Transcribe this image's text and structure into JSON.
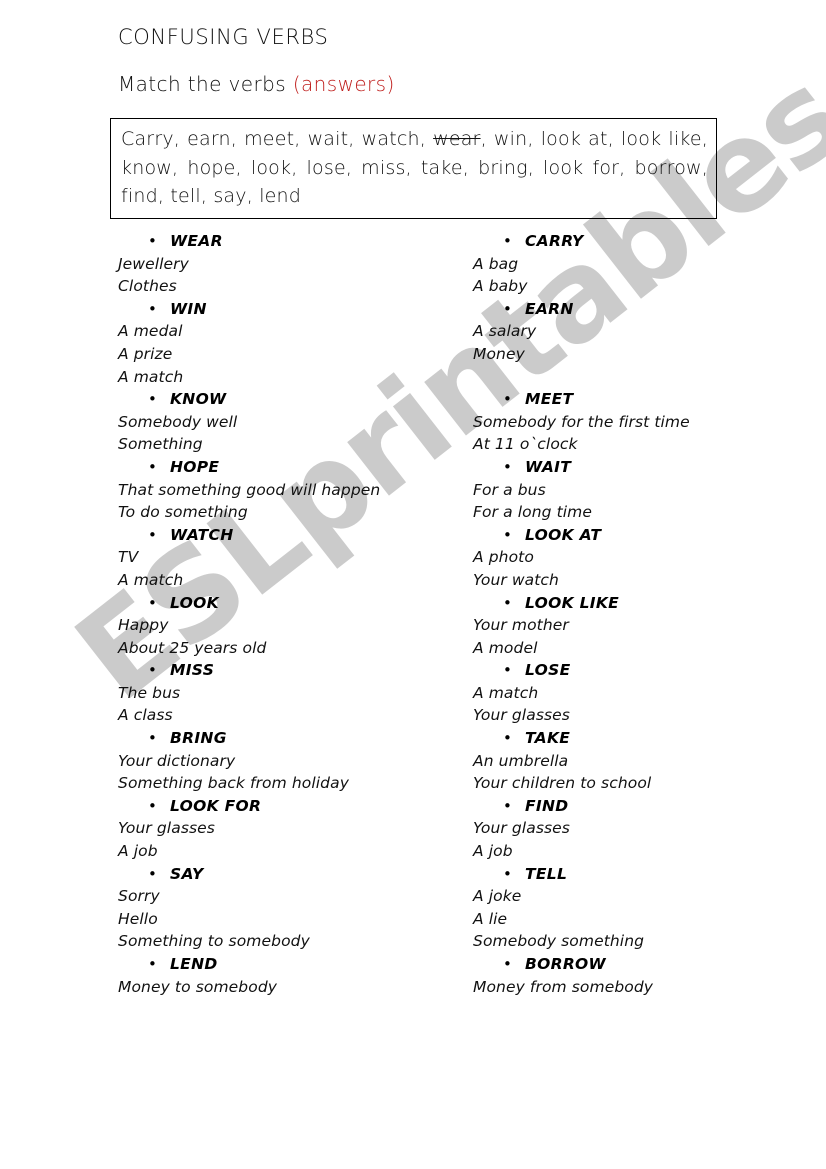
{
  "header": {
    "title": "CONFUSING VERBS",
    "subtitle_main": "Match the verbs ",
    "subtitle_answers": "(answers)"
  },
  "wordbank": {
    "before_struck": "Carry, earn, meet, wait, watch, ",
    "struck": "wear",
    "after_struck": ", win, look at, look like, know, hope, look, lose, miss, take, bring, look for, borrow, find, tell, say, lend"
  },
  "bullet_glyph": "•",
  "columns": {
    "left": [
      {
        "verb": "WEAR",
        "items": [
          "Jewellery",
          "Clothes"
        ]
      },
      {
        "verb": "WIN",
        "items": [
          "A medal",
          "A prize",
          "A match"
        ]
      },
      {
        "verb": "KNOW",
        "items": [
          "Somebody well",
          "Something"
        ]
      },
      {
        "verb": "HOPE",
        "items": [
          "That something good will happen",
          "To do something"
        ]
      },
      {
        "verb": "WATCH",
        "items": [
          "TV",
          "A match"
        ]
      },
      {
        "verb": "LOOK",
        "items": [
          "Happy",
          "About 25 years old"
        ]
      },
      {
        "verb": "MISS",
        "items": [
          "The bus",
          "A class"
        ]
      },
      {
        "verb": "BRING",
        "items": [
          "Your dictionary",
          "Something back from holiday"
        ]
      },
      {
        "verb": "LOOK FOR",
        "items": [
          "Your glasses",
          "A job"
        ]
      },
      {
        "verb": "SAY",
        "items": [
          "Sorry",
          "Hello",
          "Something to somebody"
        ]
      },
      {
        "verb": "LEND",
        "items": [
          "Money to somebody"
        ]
      }
    ],
    "right": [
      {
        "verb": "CARRY",
        "items": [
          "A bag",
          "A baby"
        ]
      },
      {
        "verb": "EARN",
        "items": [
          "A salary",
          "Money"
        ],
        "gap_after": true
      },
      {
        "verb": "MEET",
        "items": [
          "Somebody for the first time",
          "At 11 o`clock"
        ]
      },
      {
        "verb": "WAIT",
        "items": [
          "For a bus",
          "For a long time"
        ]
      },
      {
        "verb": "LOOK AT",
        "items": [
          "A photo",
          "Your watch"
        ]
      },
      {
        "verb": "LOOK LIKE",
        "items": [
          "Your mother",
          "A model"
        ]
      },
      {
        "verb": "LOSE",
        "items": [
          "A match",
          "Your glasses"
        ]
      },
      {
        "verb": "TAKE",
        "items": [
          "An umbrella",
          "Your children to school"
        ]
      },
      {
        "verb": "FIND",
        "items": [
          "Your glasses",
          "A job"
        ]
      },
      {
        "verb": "TELL",
        "items": [
          "A joke",
          "A lie",
          "Somebody something"
        ]
      },
      {
        "verb": "BORROW",
        "items": [
          "Money from somebody"
        ]
      }
    ]
  },
  "watermark": {
    "text": "ESLprintables.com",
    "color": "#c9c9c9"
  },
  "colors": {
    "accent_red": "#bf1e1c",
    "text": "#111111",
    "border": "#000000"
  }
}
